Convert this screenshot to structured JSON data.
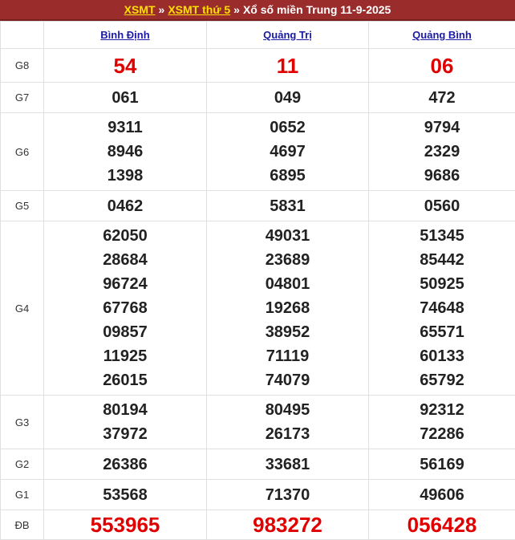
{
  "header": {
    "link1": "XSMT",
    "sep1": "»",
    "link2": "XSMT thứ 5",
    "sep2": "»",
    "text": "Xổ số miền Trung 11-9-2025"
  },
  "provinces": [
    "Bình Định",
    "Quảng Trị",
    "Quảng Bình"
  ],
  "prizes": [
    {
      "label": "G8",
      "values": [
        [
          "54"
        ],
        [
          "11"
        ],
        [
          "06"
        ]
      ]
    },
    {
      "label": "G7",
      "values": [
        [
          "061"
        ],
        [
          "049"
        ],
        [
          "472"
        ]
      ]
    },
    {
      "label": "G6",
      "values": [
        [
          "9311",
          "8946",
          "1398"
        ],
        [
          "0652",
          "4697",
          "6895"
        ],
        [
          "9794",
          "2329",
          "9686"
        ]
      ]
    },
    {
      "label": "G5",
      "values": [
        [
          "0462"
        ],
        [
          "5831"
        ],
        [
          "0560"
        ]
      ]
    },
    {
      "label": "G4",
      "values": [
        [
          "62050",
          "28684",
          "96724",
          "67768",
          "09857",
          "11925",
          "26015"
        ],
        [
          "49031",
          "23689",
          "04801",
          "19268",
          "38952",
          "71119",
          "74079"
        ],
        [
          "51345",
          "85442",
          "50925",
          "74648",
          "65571",
          "60133",
          "65792"
        ]
      ]
    },
    {
      "label": "G3",
      "values": [
        [
          "80194",
          "37972"
        ],
        [
          "80495",
          "26173"
        ],
        [
          "92312",
          "72286"
        ]
      ]
    },
    {
      "label": "G2",
      "values": [
        [
          "26386"
        ],
        [
          "33681"
        ],
        [
          "56169"
        ]
      ]
    },
    {
      "label": "G1",
      "values": [
        [
          "53568"
        ],
        [
          "71370"
        ],
        [
          "49606"
        ]
      ]
    },
    {
      "label": "ĐB",
      "values": [
        [
          "553965"
        ],
        [
          "983272"
        ],
        [
          "056428"
        ]
      ]
    }
  ],
  "colors": {
    "header_bg": "#9b2c2c",
    "header_link": "#ffe000",
    "special_number": "#e10000",
    "province_link": "#1a1aa6"
  }
}
